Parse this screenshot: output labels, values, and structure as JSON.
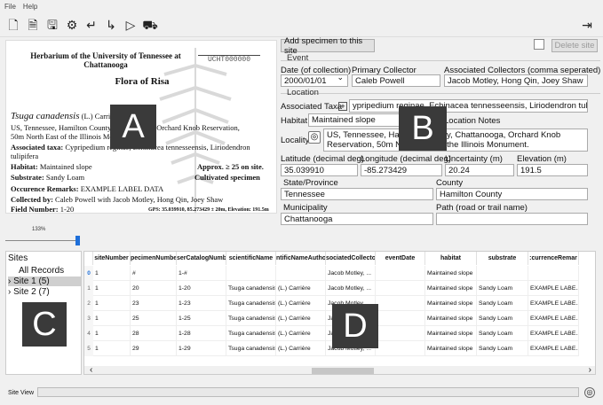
{
  "menu": [
    "File",
    "Help"
  ],
  "toolbar": {
    "icons": [
      "new-file-icon",
      "document-icon",
      "save-icon",
      "gear-icon",
      "undo-icon",
      "redo-icon",
      "play-icon",
      "truck-icon",
      "exit-icon"
    ]
  },
  "label": {
    "header": "Herbarium of the University of Tennessee at Chattanooga",
    "catalog": "UCHT000000",
    "flora": "Flora of Risa",
    "taxon": "Tsuga canadensis",
    "taxon_author": "(L.) Carrière",
    "locality": "US, Tennessee, Hamilton County, Chattanooga, Orchard Knob Reservation,",
    "locality2": "50m North East of the Illinois Monument.",
    "assoc_lbl": "Associated taxa:",
    "assoc": "Cypripedium reginae, Echinacea tennesseensis, Liriodendron",
    "assoc2": "tulipifera",
    "habitat_lbl": "Habitat:",
    "habitat": "Maintained slope",
    "approx": "Approx. ≥ 25 on site.",
    "substrate_lbl": "Substrate:",
    "substrate": "Sandy Loam",
    "cultivated": "Cultivated specimen",
    "remarks_lbl": "Occurence Remarks:",
    "remarks": "EXAMPLE LABEL DATA",
    "collected_lbl": "Collected by:",
    "collected": "Caleb Powell with Jacob Motley, Hong Qin, Joey Shaw",
    "field_lbl": "Field Number:",
    "field": "1-20",
    "gps": "GPS: 35.039910, 85.273429 ± 20m, Elevation: 191.5m",
    "zoom": "133%"
  },
  "overlays": {
    "a": "A",
    "b": "B",
    "c": "C",
    "d": "D"
  },
  "form": {
    "add_btn": "Add specimen to this site",
    "delete_btn": "Delete site",
    "event": "Event",
    "date_lbl": "Date (of collection)",
    "date_val": "2000/01/01",
    "pc_lbl": "Primary Collector",
    "pc_val": "Caleb Powell",
    "ac_lbl": "Associated Collectors (comma seperated)",
    "ac_val": "Jacob Motley, Hong Qin, Joey Shaw",
    "location": "Location",
    "at_lbl": "Associated Taxa",
    "at_val": "ypripedium reginae, Echinacea tennesseensis, Liriodendron tulipifera",
    "hab_lbl": "Habitat",
    "hab_val": "Maintained slope",
    "notes_lbl": "Location Notes",
    "loc_lbl": "Locality",
    "loc_val": "US, Tennessee, Hamilton County, Chattanooga, Orchard Knob Reservation, 50m North East of the Illinois Monument.",
    "lat_lbl": "Latitude (decimal deg)",
    "lat_val": "35.039910",
    "lon_lbl": "Longitude (decimal deg)",
    "lon_val": "-85.273429",
    "unc_lbl": "Uncertainty (m)",
    "unc_val": "20.24",
    "elev_lbl": "Elevation (m)",
    "elev_val": "191.5",
    "state_lbl": "State/Province",
    "state_val": "Tennessee",
    "county_lbl": "County",
    "county_val": "Hamilton County",
    "muni_lbl": "Municipality",
    "muni_val": "Chattanooga",
    "path_lbl": "Path (road or trail name)",
    "path_val": ""
  },
  "sites": {
    "title": "Sites",
    "items": [
      "All Records",
      "Site 1 (5)",
      "Site 2 (7)"
    ]
  },
  "table": {
    "columns": [
      "",
      "siteNumber",
      "pecimenNumbe",
      "serCatalogNumb",
      "scientificName",
      "ntificNameAutho",
      "sociatedCollecto",
      "eventDate",
      "habitat",
      "substrate",
      ":currenceRemar"
    ],
    "rows": [
      [
        "0",
        "1",
        "#",
        "1-#",
        "",
        "",
        "Jacob Motley, ...",
        "",
        "Maintained slope",
        "",
        ""
      ],
      [
        "1",
        "1",
        "20",
        "1-20",
        "Tsuga canadensis",
        "(L.) Carrière",
        "Jacob Motley, ...",
        "",
        "Maintained slope",
        "Sandy Loam",
        "EXAMPLE LABE..."
      ],
      [
        "2",
        "1",
        "23",
        "1-23",
        "Tsuga canadensis",
        "(L.) Carrière",
        "Jacob Motley, ...",
        "",
        "Maintained slope",
        "Sandy Loam",
        "EXAMPLE LABE..."
      ],
      [
        "3",
        "1",
        "25",
        "1-25",
        "Tsuga canadensis",
        "(L.) Carrière",
        "Jacob Motley, ...",
        "",
        "Maintained slope",
        "Sandy Loam",
        "EXAMPLE LABE..."
      ],
      [
        "4",
        "1",
        "28",
        "1-28",
        "Tsuga canadensis",
        "(L.) Carrière",
        "Jacob Motley, ...",
        "",
        "Maintained slope",
        "Sandy Loam",
        "EXAMPLE LABE..."
      ],
      [
        "5",
        "1",
        "29",
        "1-29",
        "Tsuga canadensis",
        "(L.) Carrière",
        "Jacob Motley, ...",
        "",
        "Maintained slope",
        "Sandy Loam",
        "EXAMPLE LABE..."
      ]
    ]
  },
  "status": {
    "text": "Site View"
  }
}
